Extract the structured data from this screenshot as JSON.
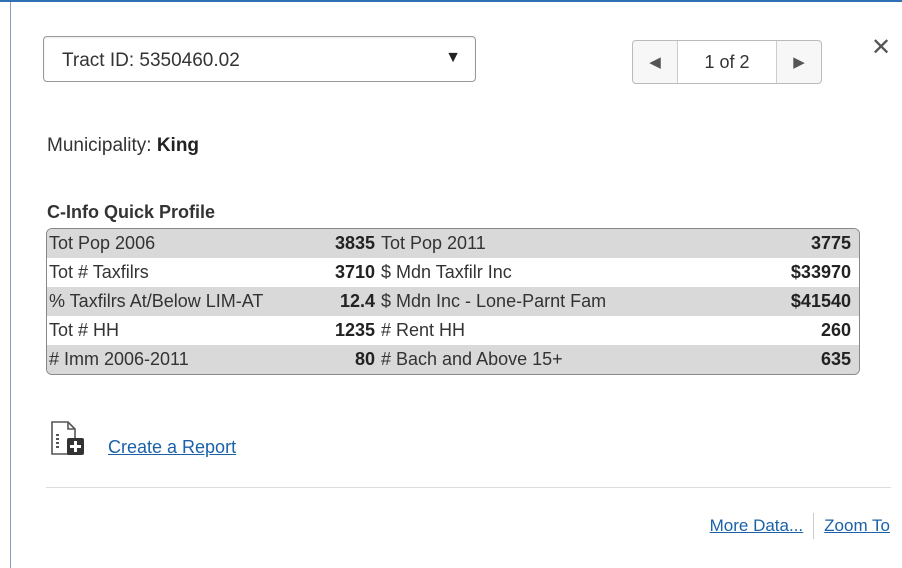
{
  "select": {
    "label": "Tract ID: 5350460.02",
    "arrow": "▼"
  },
  "pager": {
    "prev": "◀",
    "count": "1 of 2",
    "next": "▶"
  },
  "close": "✕",
  "municipality": {
    "label": "Municipality:",
    "value": "King"
  },
  "profile": {
    "title": "C-Info Quick Profile",
    "rows": [
      {
        "l1": "Tot Pop 2006",
        "v1": "3835",
        "l2": "Tot Pop 2011",
        "v2": "3775"
      },
      {
        "l1": "Tot # Taxfilrs",
        "v1": "3710",
        "l2": "$ Mdn Taxfilr Inc",
        "v2": "$33970"
      },
      {
        "l1": "% Taxfilrs At/Below LIM-AT",
        "v1": "12.4",
        "l2": "$ Mdn Inc - Lone-Parnt Fam",
        "v2": "$41540"
      },
      {
        "l1": "Tot # HH",
        "v1": "1235",
        "l2": "# Rent HH",
        "v2": "260"
      },
      {
        "l1": "# Imm 2006-2011",
        "v1": "80",
        "l2": "# Bach and Above 15+",
        "v2": "635"
      }
    ]
  },
  "report": {
    "icon": "add-document-icon",
    "label": "Create a Report"
  },
  "footer": {
    "more": "More Data...",
    "zoom": "Zoom To"
  },
  "colors": {
    "link": "#1a61a8",
    "shaded_row": "#d9d9d9",
    "top_border": "#2f6fb3"
  }
}
